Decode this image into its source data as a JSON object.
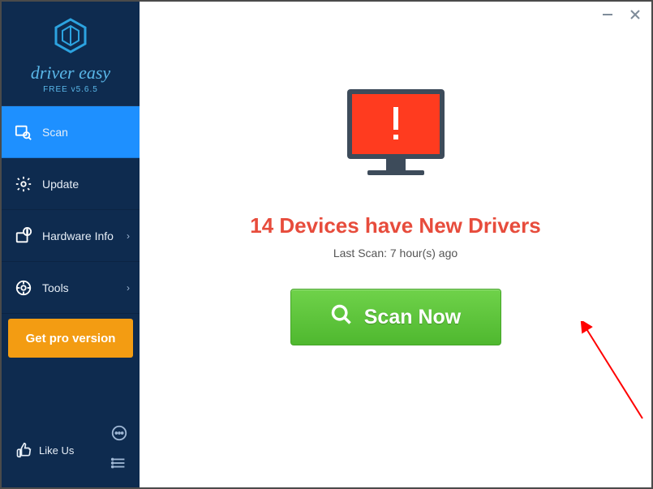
{
  "app": {
    "name": "driver easy",
    "version_label": "FREE v5.6.5"
  },
  "sidebar": {
    "items": [
      {
        "label": "Scan",
        "icon": "scan",
        "active": true,
        "chevron": false
      },
      {
        "label": "Update",
        "icon": "gear",
        "active": false,
        "chevron": false
      },
      {
        "label": "Hardware Info",
        "icon": "hardware",
        "active": false,
        "chevron": true
      },
      {
        "label": "Tools",
        "icon": "tools",
        "active": false,
        "chevron": true
      }
    ],
    "get_pro_label": "Get pro version",
    "like_label": "Like Us"
  },
  "main": {
    "headline": "14 Devices have New Drivers",
    "last_scan": "Last Scan: 7 hour(s) ago",
    "scan_button": "Scan Now"
  }
}
